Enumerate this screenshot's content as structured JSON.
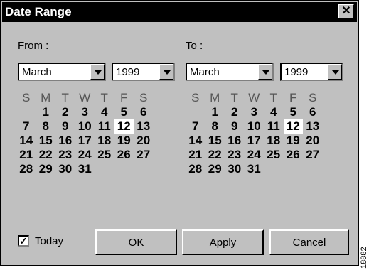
{
  "window": {
    "title": "Date Range",
    "close_glyph": "✕"
  },
  "from": {
    "label": "From :",
    "month": "March",
    "year": "1999",
    "selected_day": "12"
  },
  "to": {
    "label": "To :",
    "month": "March",
    "year": "1999",
    "selected_day": "12"
  },
  "weekday_headers": [
    "S",
    "M",
    "T",
    "W",
    "T",
    "F",
    "S"
  ],
  "calendar_weeks": [
    [
      "",
      "1",
      "2",
      "3",
      "4",
      "5",
      "6"
    ],
    [
      "7",
      "8",
      "9",
      "10",
      "11",
      "12",
      "13"
    ],
    [
      "14",
      "15",
      "16",
      "17",
      "18",
      "19",
      "20"
    ],
    [
      "21",
      "22",
      "23",
      "24",
      "25",
      "26",
      "27"
    ],
    [
      "28",
      "29",
      "30",
      "31",
      "",
      "",
      ""
    ]
  ],
  "today": {
    "checked": true,
    "label": "Today",
    "check_glyph": "✓"
  },
  "buttons": {
    "ok": {
      "mnemonic": "O",
      "rest": "K"
    },
    "apply": {
      "mnemonic": "A",
      "rest": "pply"
    },
    "cancel": {
      "mnemonic": "C",
      "rest": "ancel"
    }
  },
  "figure_id": "18882"
}
